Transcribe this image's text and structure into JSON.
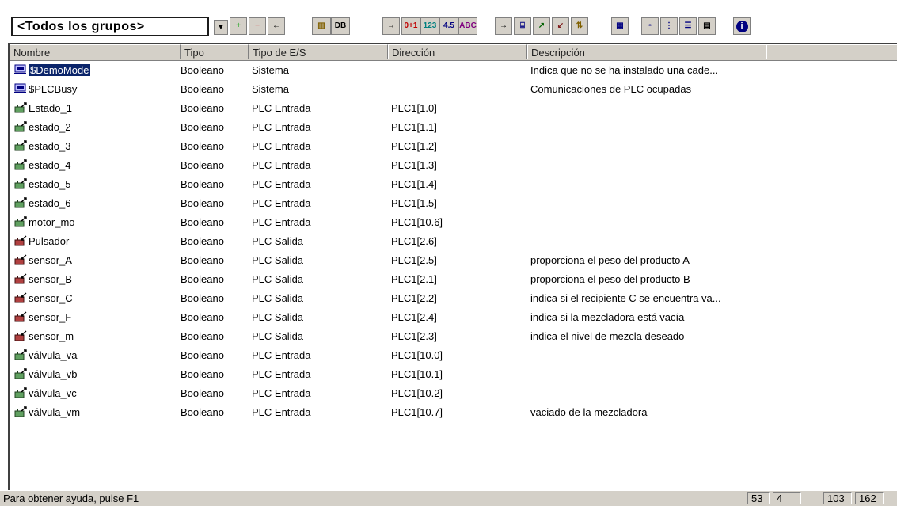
{
  "group_selector": {
    "value": "<Todos los grupos>"
  },
  "toolbar": {
    "buttons": [
      {
        "name": "add-tag-button",
        "label": "+",
        "color": "#1aa61a"
      },
      {
        "name": "delete-tag-button",
        "label": "−",
        "color": "#d81818"
      },
      {
        "name": "back-button",
        "label": "←",
        "color": "#000000"
      },
      {
        "name": "memory-button",
        "label": "▥",
        "color": "#806000"
      },
      {
        "name": "database-button",
        "label": "DB",
        "color": "#000000"
      },
      {
        "name": "arrow-button",
        "label": "→",
        "color": "#000000"
      },
      {
        "name": "bool-type-button",
        "label": "0+1",
        "color": "#c00000"
      },
      {
        "name": "int-type-button",
        "label": "123",
        "color": "#008080"
      },
      {
        "name": "float-type-button",
        "label": "4.5",
        "color": "#000080"
      },
      {
        "name": "string-type-button",
        "label": "ABC",
        "color": "#800080"
      },
      {
        "name": "arrow2-button",
        "label": "→",
        "color": "#000000"
      },
      {
        "name": "system-button",
        "label": "⌸",
        "color": "#000080"
      },
      {
        "name": "plc-input-button",
        "label": "↗",
        "color": "#006000"
      },
      {
        "name": "plc-output-button",
        "label": "↙",
        "color": "#802020"
      },
      {
        "name": "plc-io-button",
        "label": "⇅",
        "color": "#806000"
      },
      {
        "name": "table-view-button",
        "label": "▦",
        "color": "#000080"
      },
      {
        "name": "large-icons-button",
        "label": "▫",
        "color": "#000080"
      },
      {
        "name": "small-icons-button",
        "label": "⋮",
        "color": "#000080"
      },
      {
        "name": "list-view-button",
        "label": "☰",
        "color": "#000080"
      },
      {
        "name": "details-view-button",
        "label": "▤",
        "color": "#000000"
      },
      {
        "name": "info-button",
        "label": "i",
        "color": "#ffffff"
      }
    ]
  },
  "columns": [
    "Nombre",
    "Tipo",
    "Tipo de E/S",
    "Dirección",
    "Descripción"
  ],
  "rows": [
    {
      "icon": "system-icon",
      "name": "$DemoMode",
      "tipo": "Booleano",
      "es": "Sistema",
      "dir": "",
      "desc": "Indica que no se ha instalado una cade...",
      "selected": true
    },
    {
      "icon": "system-icon",
      "name": "$PLCBusy",
      "tipo": "Booleano",
      "es": "Sistema",
      "dir": "",
      "desc": "Comunicaciones de PLC ocupadas"
    },
    {
      "icon": "plc-input-icon",
      "name": "Estado_1",
      "tipo": "Booleano",
      "es": "PLC Entrada",
      "dir": "PLC1[1.0]",
      "desc": ""
    },
    {
      "icon": "plc-input-icon",
      "name": "estado_2",
      "tipo": "Booleano",
      "es": "PLC Entrada",
      "dir": "PLC1[1.1]",
      "desc": ""
    },
    {
      "icon": "plc-input-icon",
      "name": "estado_3",
      "tipo": "Booleano",
      "es": "PLC Entrada",
      "dir": "PLC1[1.2]",
      "desc": ""
    },
    {
      "icon": "plc-input-icon",
      "name": "estado_4",
      "tipo": "Booleano",
      "es": "PLC Entrada",
      "dir": "PLC1[1.3]",
      "desc": ""
    },
    {
      "icon": "plc-input-icon",
      "name": "estado_5",
      "tipo": "Booleano",
      "es": "PLC Entrada",
      "dir": "PLC1[1.4]",
      "desc": ""
    },
    {
      "icon": "plc-input-icon",
      "name": "estado_6",
      "tipo": "Booleano",
      "es": "PLC Entrada",
      "dir": "PLC1[1.5]",
      "desc": ""
    },
    {
      "icon": "plc-input-icon",
      "name": "motor_mo",
      "tipo": "Booleano",
      "es": "PLC Entrada",
      "dir": "PLC1[10.6]",
      "desc": ""
    },
    {
      "icon": "plc-output-icon",
      "name": "Pulsador",
      "tipo": "Booleano",
      "es": "PLC Salida",
      "dir": "PLC1[2.6]",
      "desc": ""
    },
    {
      "icon": "plc-output-icon",
      "name": "sensor_A",
      "tipo": "Booleano",
      "es": "PLC Salida",
      "dir": "PLC1[2.5]",
      "desc": "proporciona el peso del producto A"
    },
    {
      "icon": "plc-output-icon",
      "name": "sensor_B",
      "tipo": "Booleano",
      "es": "PLC Salida",
      "dir": "PLC1[2.1]",
      "desc": "proporciona el peso del producto B"
    },
    {
      "icon": "plc-output-icon",
      "name": "sensor_C",
      "tipo": "Booleano",
      "es": "PLC Salida",
      "dir": "PLC1[2.2]",
      "desc": "indica si el recipiente C se encuentra va..."
    },
    {
      "icon": "plc-output-icon",
      "name": "sensor_F",
      "tipo": "Booleano",
      "es": "PLC Salida",
      "dir": "PLC1[2.4]",
      "desc": "indica si la mezcladora está vacía"
    },
    {
      "icon": "plc-output-icon",
      "name": "sensor_m",
      "tipo": "Booleano",
      "es": "PLC Salida",
      "dir": "PLC1[2.3]",
      "desc": "indica el nivel de mezcla deseado"
    },
    {
      "icon": "plc-input-icon",
      "name": "válvula_va",
      "tipo": "Booleano",
      "es": "PLC Entrada",
      "dir": "PLC1[10.0]",
      "desc": ""
    },
    {
      "icon": "plc-input-icon",
      "name": "válvula_vb",
      "tipo": "Booleano",
      "es": "PLC Entrada",
      "dir": "PLC1[10.1]",
      "desc": ""
    },
    {
      "icon": "plc-input-icon",
      "name": "válvula_vc",
      "tipo": "Booleano",
      "es": "PLC Entrada",
      "dir": "PLC1[10.2]",
      "desc": ""
    },
    {
      "icon": "plc-input-icon",
      "name": "válvula_vm",
      "tipo": "Booleano",
      "es": "PLC Entrada",
      "dir": "PLC1[10.7]",
      "desc": "vaciado de la mezcladora"
    }
  ],
  "status": {
    "help": "Para obtener ayuda, pulse F1",
    "panels": [
      "53",
      "4",
      "103",
      "162"
    ]
  }
}
